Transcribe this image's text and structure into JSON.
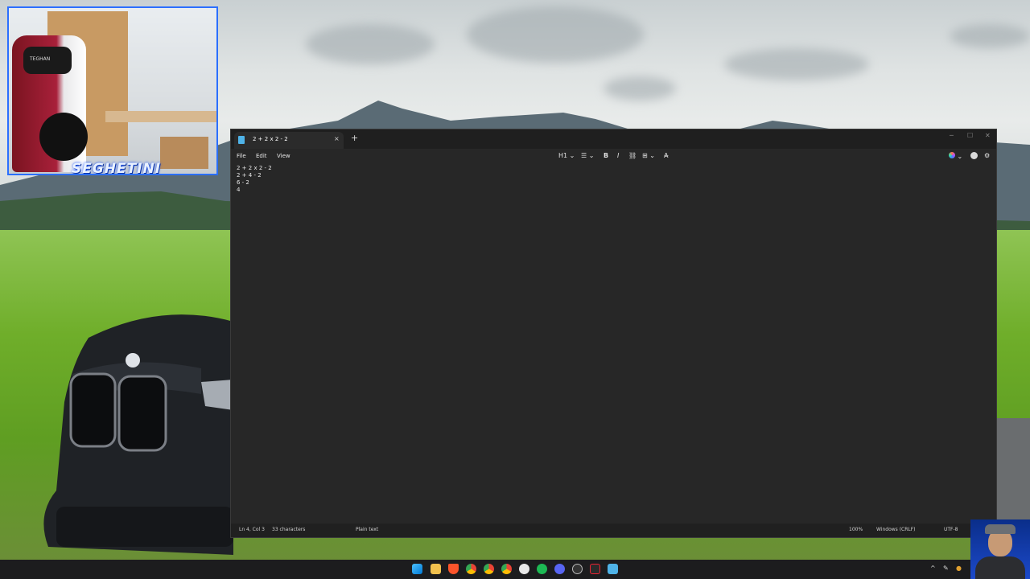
{
  "webcam": {
    "overlay_name": "SEGHETINI",
    "chair_brand": "TEGHAN"
  },
  "notepad": {
    "tab_title": "2 + 2 x 2 - 2",
    "tab_close": "×",
    "new_tab": "+",
    "menu": {
      "file": "File",
      "edit": "Edit",
      "view": "View"
    },
    "toolbar": {
      "heading": "H1",
      "list": "☰",
      "bold": "B",
      "italic": "I",
      "link": "⛓",
      "table": "⊞",
      "clear": "A̶"
    },
    "lines": [
      "2 + 2 x 2 - 2",
      "2 + 4 - 2",
      "6 - 2",
      "4"
    ],
    "status": {
      "position": "Ln 4, Col 3",
      "characters": "33 characters",
      "format": "Plain text",
      "zoom": "100%",
      "line_ending": "Windows (CRLF)",
      "encoding": "UTF-8"
    }
  },
  "taskbar": {
    "icons": [
      "start-icon",
      "file-explorer-icon",
      "brave-icon",
      "chrome-icon",
      "chrome-icon",
      "app-icon",
      "spotify-icon",
      "discord-icon",
      "obs-icon",
      "epic-games-icon",
      "notepad-icon"
    ],
    "tray_chevron": "^"
  },
  "colors": {
    "accent": "#2b6fff",
    "editor_bg": "#272727",
    "titlebar_bg": "#1f1f1f",
    "taskbar_bg": "#1c1c1e"
  }
}
